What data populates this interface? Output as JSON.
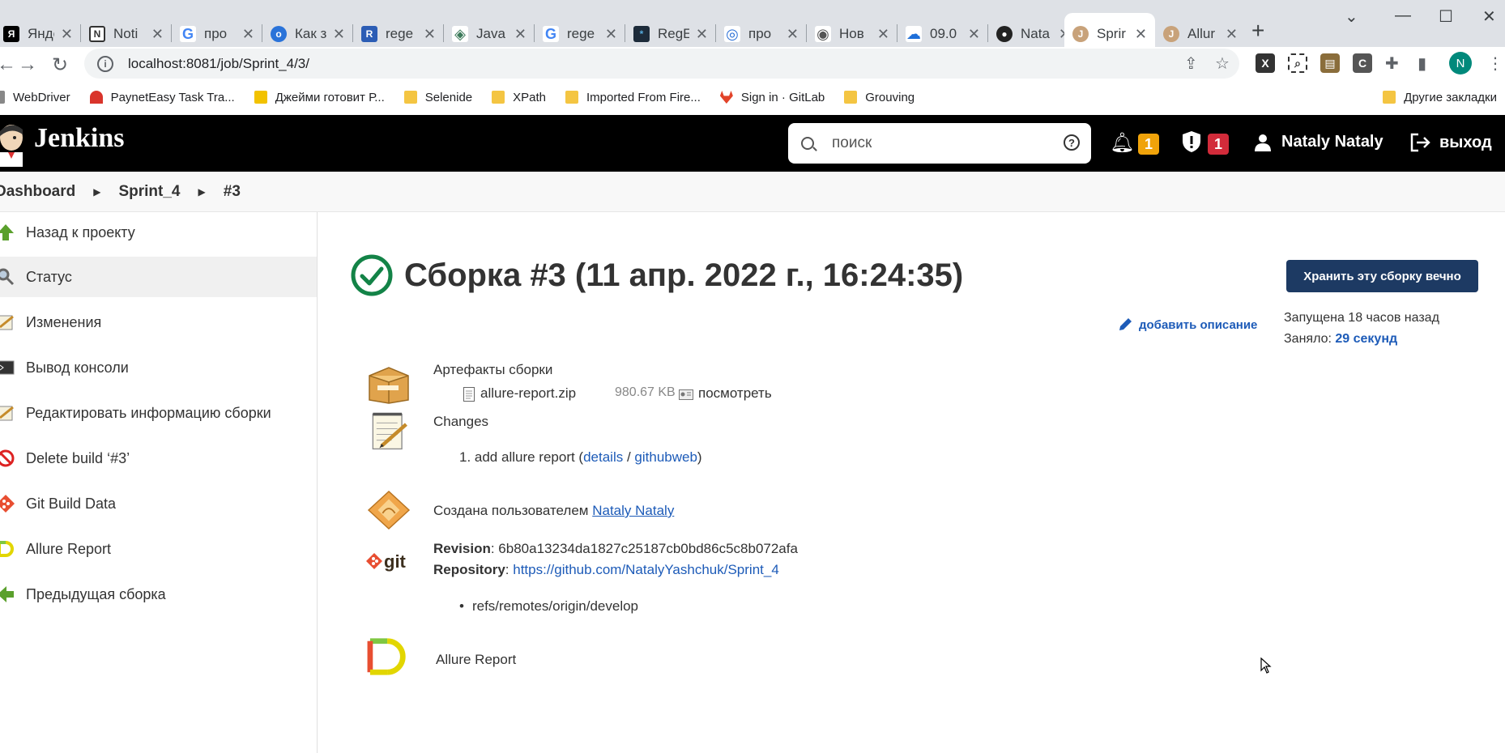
{
  "browser": {
    "tabs": [
      {
        "title": "Янде",
        "color": "#000000",
        "glyph": "Я"
      },
      {
        "title": "Noti",
        "color": "#333333",
        "glyph": "N"
      },
      {
        "title": "про",
        "color": "#4285f4",
        "glyph": "G"
      },
      {
        "title": "Как з",
        "color": "#2a73d9",
        "glyph": "o"
      },
      {
        "title": "rege",
        "color": "#2c5db5",
        "glyph": "R"
      },
      {
        "title": "Java",
        "color": "#3c7a5a",
        "glyph": "◈"
      },
      {
        "title": "rege",
        "color": "#4285f4",
        "glyph": "G"
      },
      {
        "title": "RegE",
        "color": "#1d2b3a",
        "glyph": "*"
      },
      {
        "title": "про",
        "color": "#2a6fd6",
        "glyph": "◎"
      },
      {
        "title": "Нов",
        "color": "#555555",
        "glyph": "◉"
      },
      {
        "title": "09.0",
        "color": "#1e6fd9",
        "glyph": "☁"
      },
      {
        "title": "Nata",
        "color": "#222222",
        "glyph": "●"
      },
      {
        "title": "Sprir",
        "color": "#c8a27a",
        "glyph": "J"
      },
      {
        "title": "Allur",
        "color": "#c8a27a",
        "glyph": "J"
      }
    ],
    "url": "localhost:8081/job/Sprint_4/3/",
    "bookmarks": [
      {
        "label": "WebDriver",
        "color": "#888888"
      },
      {
        "label": "PaynetEasy Task Tra...",
        "color": "#d9342b"
      },
      {
        "label": "Джейми готовит Р...",
        "color": "#f2c200"
      },
      {
        "label": "Selenide",
        "color": "#f4c542"
      },
      {
        "label": "XPath",
        "color": "#f4c542"
      },
      {
        "label": "Imported From Fire...",
        "color": "#f4c542"
      },
      {
        "label": "Sign in · GitLab",
        "color": "#e24329"
      },
      {
        "label": "Grouving",
        "color": "#f4c542"
      }
    ],
    "other_bookmarks": "Другие закладки",
    "profile_initial": "N"
  },
  "jenkins": {
    "title": "Jenkins",
    "search_placeholder": "поиск",
    "notif_count": "1",
    "security_count": "1",
    "user": "Nataly Nataly",
    "logout": "выход"
  },
  "breadcrumb": [
    "Dashboard",
    "Sprint_4",
    "#3"
  ],
  "sidebar": [
    {
      "label": "Назад к проекту",
      "icon": "up-arrow-icon"
    },
    {
      "label": "Статус",
      "icon": "magnifier-icon"
    },
    {
      "label": "Изменения",
      "icon": "notepad-icon"
    },
    {
      "label": "Вывод консоли",
      "icon": "terminal-icon"
    },
    {
      "label": "Редактировать информацию сборки",
      "icon": "notepad-icon"
    },
    {
      "label": "Delete build ‘#3’",
      "icon": "no-entry-icon"
    },
    {
      "label": "Git Build Data",
      "icon": "git-icon"
    },
    {
      "label": "Allure Report",
      "icon": "allure-icon"
    },
    {
      "label": "Предыдущая сборка",
      "icon": "left-arrow-icon"
    }
  ],
  "build": {
    "title": "Сборка #3 (11 апр. 2022 г., 16:24:35)",
    "keep_button": "Хранить эту сборку вечно",
    "started": "Запущена 18 часов назад",
    "took_label": "Заняло: ",
    "took_value": "29 секунд",
    "add_description": "добавить описание",
    "artifacts_label": "Артефакты сборки",
    "artifact_file": "allure-report.zip",
    "artifact_size": "980.67 KB",
    "artifact_view": "посмотреть",
    "changes_label": "Changes",
    "change_item": "1. add allure report (",
    "change_details": "details",
    "change_slash": " / ",
    "change_githubweb": "githubweb",
    "change_close": ")",
    "created_by": "Создана пользователем ",
    "created_user": "Nataly Nataly",
    "revision_label": "Revision",
    "revision_value": ": 6b80a13234da1827c25187cb0bd86c5c8b072afa",
    "repository_label": "Repository",
    "repository_colon": ": ",
    "repository_url": "https://github.com/NatalyYashchuk/Sprint_4",
    "ref": "refs/remotes/origin/develop",
    "allure_link": "Allure Report"
  }
}
